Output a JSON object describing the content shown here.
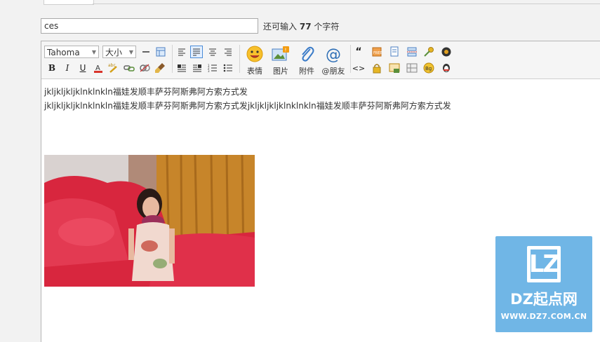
{
  "subject": {
    "value": "ces",
    "hint_prefix": "还可输入",
    "hint_count": "77",
    "hint_suffix": "个字符"
  },
  "toolbar": {
    "font_name": "Tahoma",
    "font_size": "大小",
    "emoticon_label": "表情",
    "image_label": "图片",
    "attachment_label": "附件",
    "mention_label": "@朋友",
    "bold": "B",
    "italic": "I",
    "underline": "U",
    "quote": "“",
    "code": "<>",
    "bg": "Bg"
  },
  "content": {
    "line1": "jkljkljkljklnklnkln福娃发顺丰萨芬阿斯弗阿方索方式发",
    "line2": "jkljkljkljklnklnkln福娃发顺丰萨芬阿斯弗阿方索方式发jkljkljkljklnklnkln福娃发顺丰萨芬阿斯弗阿方索方式发"
  },
  "watermark": {
    "logo": "LZ",
    "name": "DZ起点网",
    "url": "WWW.DZ7.COM.CN"
  }
}
